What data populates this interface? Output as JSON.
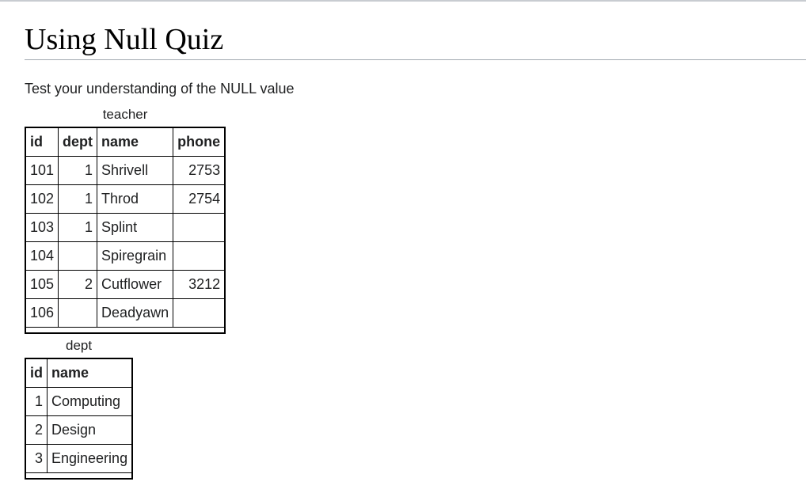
{
  "page": {
    "title": "Using Null Quiz",
    "intro": "Test your understanding of the NULL value"
  },
  "teacher": {
    "caption": "teacher",
    "headers": [
      "id",
      "dept",
      "name",
      "phone"
    ],
    "rows": [
      [
        "101",
        "1",
        "Shrivell",
        "2753"
      ],
      [
        "102",
        "1",
        "Throd",
        "2754"
      ],
      [
        "103",
        "1",
        "Splint",
        ""
      ],
      [
        "104",
        "",
        "Spiregrain",
        ""
      ],
      [
        "105",
        "2",
        "Cutflower",
        "3212"
      ],
      [
        "106",
        "",
        "Deadyawn",
        ""
      ]
    ]
  },
  "dept": {
    "caption": "dept",
    "headers": [
      "id",
      "name"
    ],
    "rows": [
      [
        "1",
        "Computing"
      ],
      [
        "2",
        "Design"
      ],
      [
        "3",
        "Engineering"
      ]
    ]
  }
}
